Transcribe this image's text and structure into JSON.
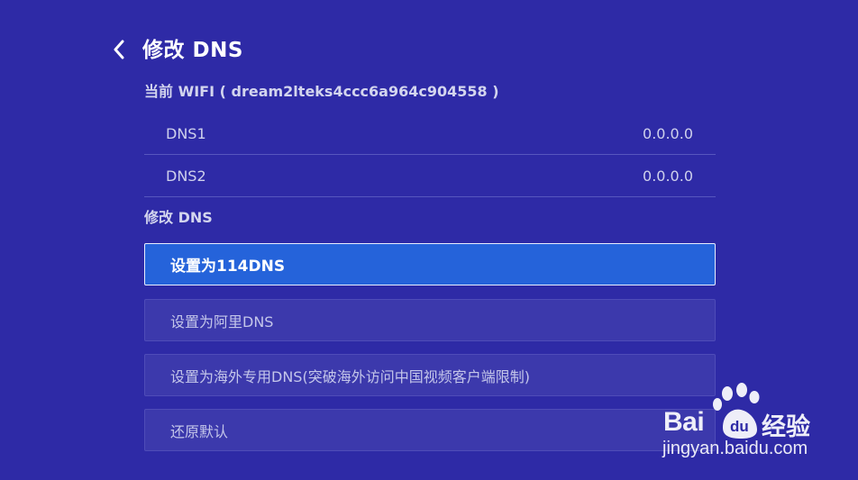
{
  "header": {
    "title": "修改 DNS"
  },
  "wifi": {
    "label": "当前 WIFI ( dream2lteks4ccc6a964c904558 )"
  },
  "dns_rows": [
    {
      "name": "DNS1",
      "value": "0.0.0.0"
    },
    {
      "name": "DNS2",
      "value": "0.0.0.0"
    }
  ],
  "section": {
    "label": "修改 DNS"
  },
  "options": [
    {
      "label": "设置为114DNS",
      "selected": true
    },
    {
      "label": "设置为阿里DNS",
      "selected": false
    },
    {
      "label": "设置为海外专用DNS(突破海外访问中国视频客户端限制)",
      "selected": false
    },
    {
      "label": "还原默认",
      "selected": false
    }
  ],
  "watermark": {
    "brand": "Bai",
    "brand_suffix": "经验",
    "du_glyph": "du",
    "url": "jingyan.baidu.com"
  },
  "colors": {
    "background": "#2e2aa6",
    "selected": "#2563da",
    "option": "#3c39ac"
  }
}
